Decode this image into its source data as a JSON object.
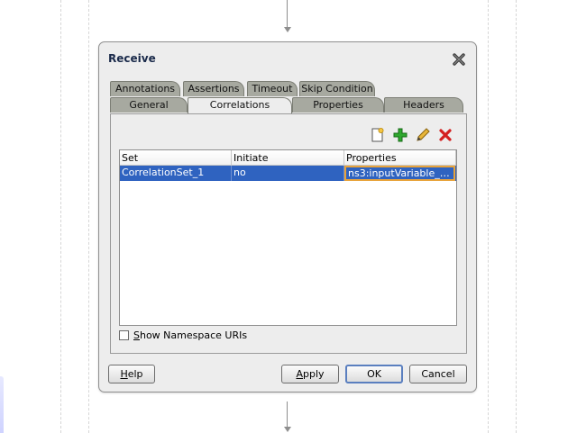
{
  "dialog": {
    "title": "Receive",
    "close_icon": "close-icon"
  },
  "tabs": {
    "row_top": [
      "Annotations",
      "Assertions",
      "Timeout",
      "Skip Condition"
    ],
    "row_bottom": [
      "General",
      "Correlations",
      "Properties",
      "Headers"
    ],
    "active": "Correlations"
  },
  "toolbar": {
    "icons": [
      "new-document-icon",
      "add-icon",
      "edit-pencil-icon",
      "delete-icon"
    ]
  },
  "table": {
    "columns": [
      "Set",
      "Initiate",
      "Properties"
    ],
    "rows": [
      {
        "set": "CorrelationSet_1",
        "initiate": "no",
        "properties": "ns3:inputVariable_payl..."
      }
    ],
    "selected_color": "#2f63c0"
  },
  "options": {
    "show_namespace_label_prefix": "S",
    "show_namespace_label_rest": "how Namespace URIs",
    "show_namespace_checked": false
  },
  "buttons": {
    "help_u": "H",
    "help_rest": "elp",
    "apply_u": "A",
    "apply_rest": "pply",
    "ok": "OK",
    "cancel": "Cancel"
  }
}
